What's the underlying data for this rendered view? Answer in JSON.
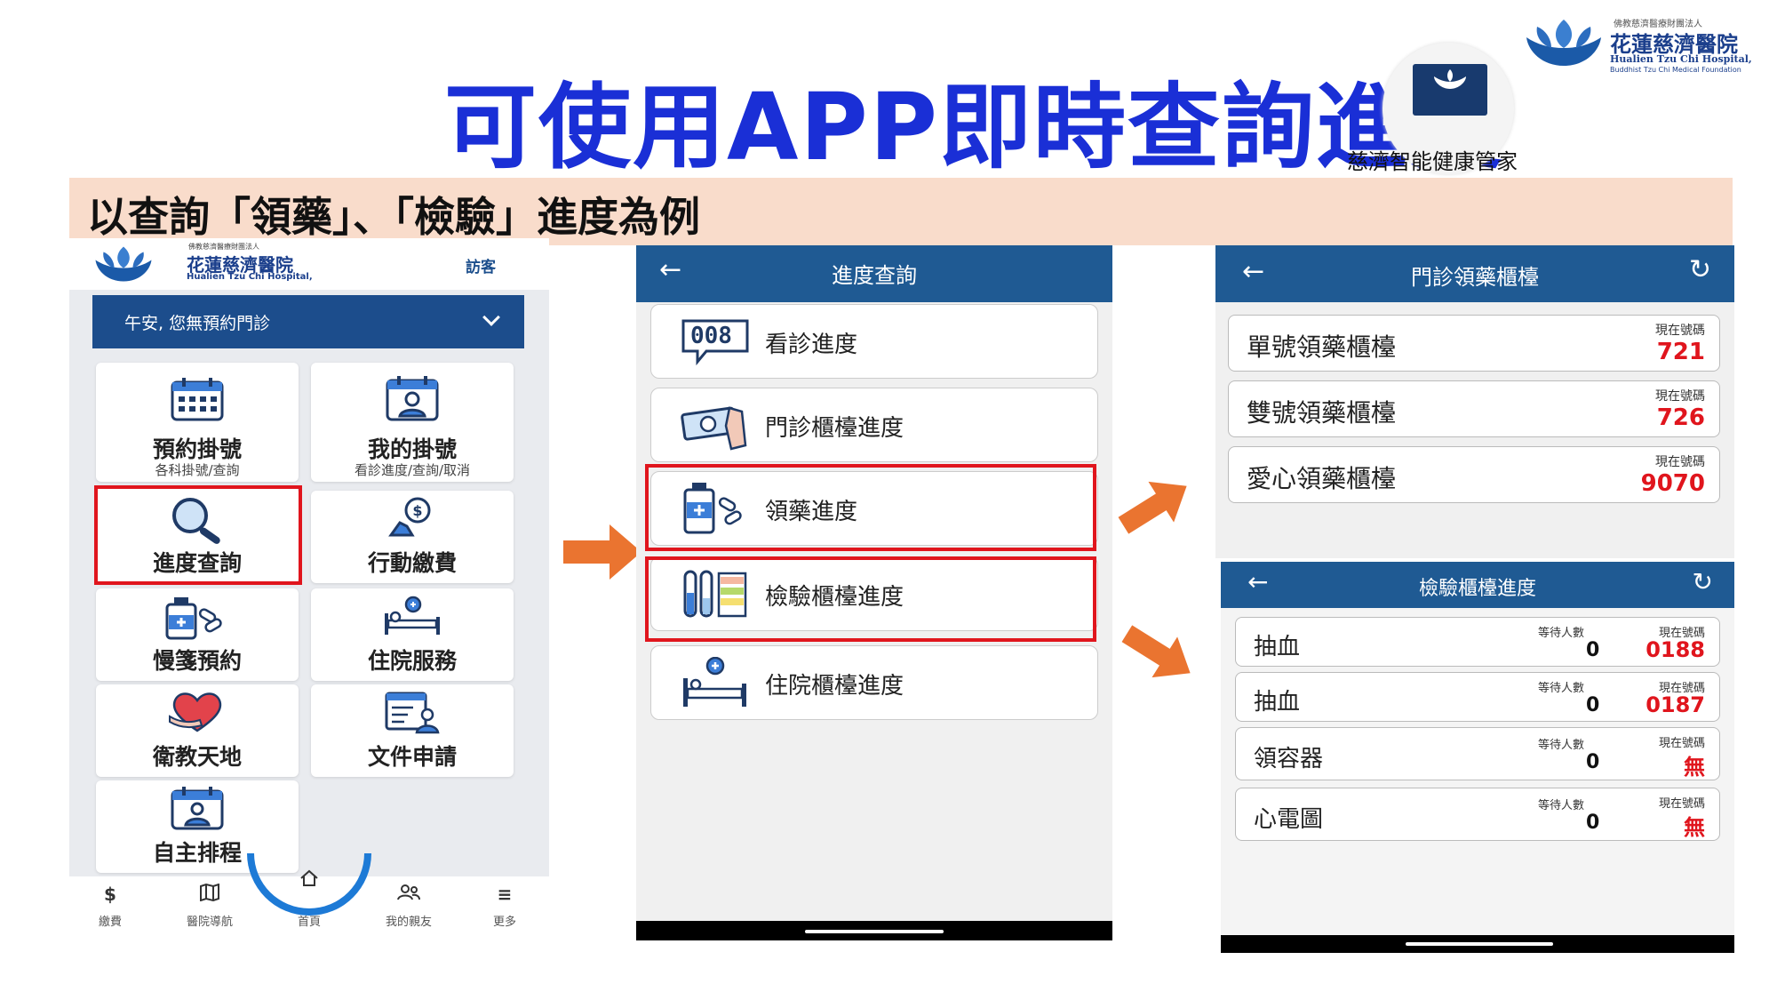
{
  "slide": {
    "title": "可使用APP即時查詢進度",
    "subtitle": "以查詢「領藥」、「檢驗」進度為例",
    "app_icon_label": "慈濟智能健康管家"
  },
  "hospital_logo": {
    "foundation": "佛教慈濟醫療財團法人",
    "name_zh": "花蓮慈濟醫院",
    "name_en": "Hualien Tzu Chi Hospital,",
    "name_en_sub": "Buddhist Tzu Chi Medical Foundation"
  },
  "colors": {
    "title_blue": "#1a2fd6",
    "app_header_blue": "#1f5a93",
    "highlight_red": "#e0151d",
    "arrow_orange": "#ea7430",
    "subtitle_band": "#f9dccb"
  },
  "home_app": {
    "guest_label": "訪客",
    "greeting": "午安, 您無預約門診",
    "tiles": [
      {
        "label": "預約掛號",
        "sub": "各科掛號/查詢",
        "icon": "calendar-icon"
      },
      {
        "label": "我的掛號",
        "sub": "看診進度/查詢/取消",
        "icon": "user-calendar-icon"
      },
      {
        "label": "進度查詢",
        "sub": "",
        "icon": "magnifier-icon"
      },
      {
        "label": "行動繳費",
        "sub": "",
        "icon": "payment-hand-icon"
      },
      {
        "label": "慢箋預約",
        "sub": "",
        "icon": "medicine-bottle-icon"
      },
      {
        "label": "住院服務",
        "sub": "",
        "icon": "hospital-bed-icon"
      },
      {
        "label": "衛教天地",
        "sub": "",
        "icon": "heart-hands-icon"
      },
      {
        "label": "文件申請",
        "sub": "",
        "icon": "document-user-icon"
      },
      {
        "label": "自主排程",
        "sub": "",
        "icon": "schedule-user-icon"
      }
    ],
    "nav": [
      {
        "label": "繳費",
        "icon": "dollar-icon"
      },
      {
        "label": "醫院導航",
        "icon": "map-icon"
      },
      {
        "label": "首頁",
        "icon": "home-icon"
      },
      {
        "label": "我的親友",
        "icon": "friends-icon"
      },
      {
        "label": "更多",
        "icon": "menu-icon"
      }
    ]
  },
  "progress_app": {
    "title": "進度查詢",
    "items": [
      {
        "label": "看診進度",
        "icon": "number-bubble-icon",
        "icon_text": "008"
      },
      {
        "label": "門診櫃檯進度",
        "icon": "cash-hand-icon"
      },
      {
        "label": "領藥進度",
        "icon": "medicine-bottle-icon"
      },
      {
        "label": "檢驗櫃檯進度",
        "icon": "test-tube-icon"
      },
      {
        "label": "住院櫃檯進度",
        "icon": "hospital-bed-icon"
      }
    ]
  },
  "pharmacy_app": {
    "title": "門診領藥櫃檯",
    "current_label": "現在號碼",
    "counters": [
      {
        "name": "單號領藥櫃檯",
        "current": "721"
      },
      {
        "name": "雙號領藥櫃檯",
        "current": "726"
      },
      {
        "name": "愛心領藥櫃檯",
        "current": "9070"
      }
    ]
  },
  "lab_app": {
    "title": "檢驗櫃檯進度",
    "waiting_label": "等待人數",
    "current_label": "現在號碼",
    "counters": [
      {
        "name": "抽血",
        "waiting": "0",
        "current": "0188"
      },
      {
        "name": "抽血",
        "waiting": "0",
        "current": "0187"
      },
      {
        "name": "領容器",
        "waiting": "0",
        "current": "無"
      },
      {
        "name": "心電圖",
        "waiting": "0",
        "current": "無"
      }
    ]
  }
}
